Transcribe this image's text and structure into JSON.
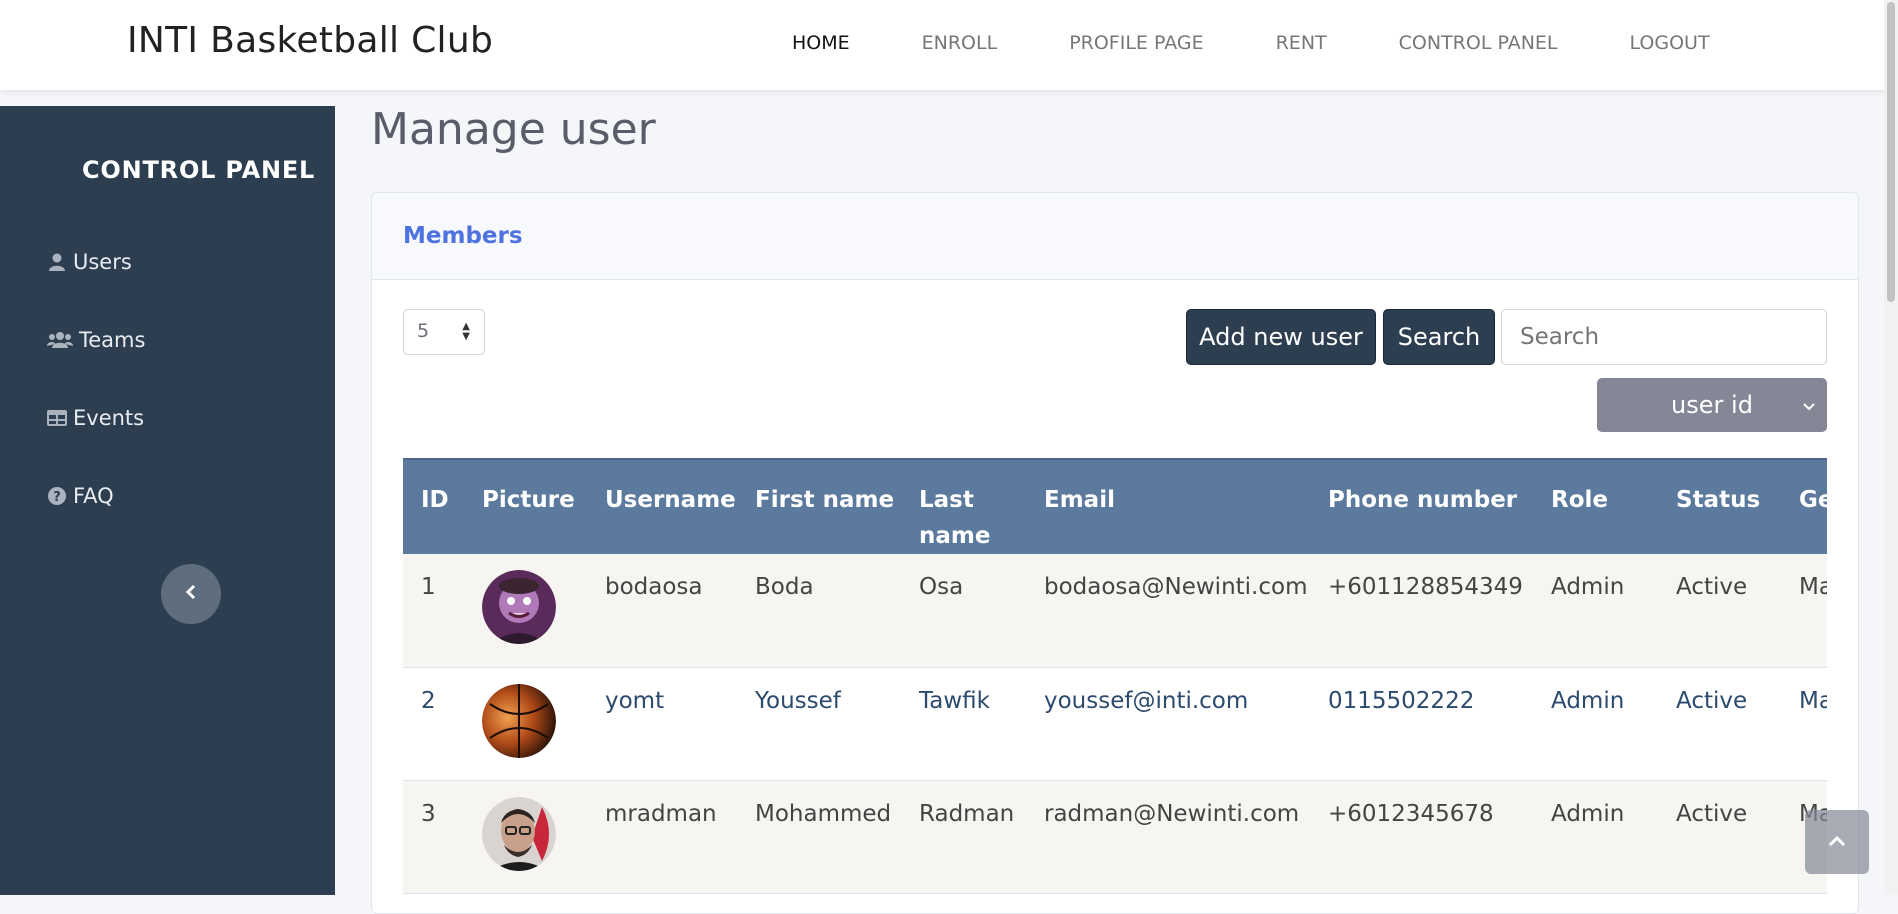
{
  "navbar": {
    "brand": "INTI Basketball Club",
    "links": [
      "HOME",
      "ENROLL",
      "PROFILE PAGE",
      "RENT",
      "CONTROL PANEL",
      "LOGOUT"
    ],
    "active": "HOME"
  },
  "sidebar": {
    "title": "CONTROL PANEL",
    "items": [
      {
        "label": "Users",
        "icon": "user-icon"
      },
      {
        "label": "Teams",
        "icon": "users-icon"
      },
      {
        "label": "Events",
        "icon": "table-icon"
      },
      {
        "label": "FAQ",
        "icon": "question-circle-icon"
      }
    ]
  },
  "main": {
    "page_title": "Manage user",
    "card_title": "Members",
    "entries_value": "5",
    "add_button": "Add new user",
    "search_button": "Search",
    "search_placeholder": "Search",
    "sort_value": "user id",
    "columns": [
      "ID",
      "Picture",
      "Username",
      "First name",
      "Last name",
      "Email",
      "Phone number",
      "Role",
      "Status",
      "Gender"
    ],
    "rows": [
      {
        "id": "1",
        "username": "bodaosa",
        "first": "Boda",
        "last": "Osa",
        "email": "bodaosa@Newinti.com",
        "phone": "+601128854349",
        "role": "Admin",
        "status": "Active",
        "gender": "Male"
      },
      {
        "id": "2",
        "username": "yomt",
        "first": "Youssef",
        "last": "Tawfik",
        "email": "youssef@inti.com",
        "phone": "0115502222",
        "role": "Admin",
        "status": "Active",
        "gender": "Male"
      },
      {
        "id": "3",
        "username": "mradman",
        "first": "Mohammed",
        "last": "Radman",
        "email": "radman@Newinti.com",
        "phone": "+6012345678",
        "role": "Admin",
        "status": "Active",
        "gender": "Male"
      }
    ]
  },
  "colors": {
    "sidebar_bg": "#2c3e50",
    "table_header_bg": "#5b7a9d",
    "accent": "#4e73df"
  }
}
